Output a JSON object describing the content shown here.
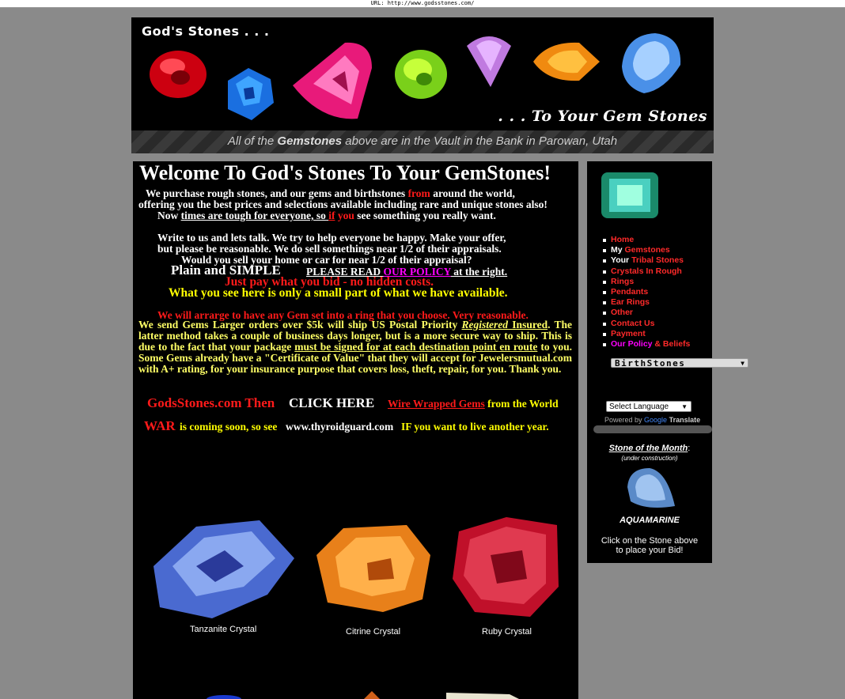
{
  "url_bar": "URL: http://www.godsstones.com/",
  "header": {
    "brand": "God's Stones . . .",
    "tagline": ". . . To Your Gem Stones",
    "vault_pre": "All of the ",
    "vault_bold": "Gemstones",
    "vault_post": " above are in the Vault in the Bank in Parowan, Utah"
  },
  "main": {
    "title": "Welcome To God's Stones To Your GemStones!",
    "l1a": "We purchase rough stones, and our gems and birthstones ",
    "l1b": "from",
    "l1c": " around the world,",
    "l2": "offering you the best prices and selections available including rare and unique stones also!",
    "l3a": "Now ",
    "l3b": "times are tough for everyone, so ",
    "l3c": "if",
    "l3d": " you",
    "l3e": " see something you really want.",
    "l4": "Write to us and lets talk. We try to help everyone be happy. Make your offer,",
    "l5": "but please be reasonable. We do sell somethings near 1/2 of their appraisals.",
    "l6": "Would you sell your home or car for near 1/2 of their appraisal?",
    "l7a": "Plain and SIMPLE",
    "l7b": "PLEASE READ ",
    "l7c": "OUR POLICY",
    "l7d": "  at the right. ",
    "l8": "Just pay what you bid - no hidden costs.",
    "l9": "What you see here is only a small part of what we have available.",
    "l10": "We will arrarge to have any Gem set into a ring that you choose. Very reasonable.",
    "j1": "We send Gems Larger orders over $5k will ship US Postal Priority ",
    "j2": "Registered",
    "j3": " Insured",
    "j4": ". The latter method takes a couple of business days longer, but is a more secure way to ship. This is due to the fact that your package ",
    "j5": "must be signed for at each destination point en route",
    "j6": " to you. Some Gems already have a \"Certificate of Value\" that they will accept for Jewelersmutual.com with A+ rating, for your insurance purpose that covers loss, theft, repair, for you.  Thank you.",
    "r1a": "GodsStones.com Then",
    "r1b": "CLICK HERE",
    "r1c": "Wire Wrapped Gems",
    "r1d": " from the World",
    "r2a": "WAR",
    "r2b": " is coming soon, so see",
    "r2c": "www.thyroidguard.com",
    "r2d": "IF you want to live another year.",
    "captions": [
      "Tanzanite Crystal",
      "Citrine Crystal",
      "Ruby Crystal"
    ]
  },
  "sidebar": {
    "menu": [
      {
        "pre": "",
        "label": "Home"
      },
      {
        "pre": "My ",
        "label": "Gemstones"
      },
      {
        "pre": "Your ",
        "label": "Tribal Stones"
      },
      {
        "pre": "",
        "label": "Crystals In Rough"
      },
      {
        "pre": "",
        "label": "Rings"
      },
      {
        "pre": "",
        "label": "Pendants"
      },
      {
        "pre": "",
        "label": "Ear Rings"
      },
      {
        "pre": "",
        "label": "Other"
      },
      {
        "pre": "",
        "label": "Contact Us"
      },
      {
        "pre": "",
        "label": "Payment"
      },
      {
        "pre": "",
        "label": "Our Policy",
        "post": " & Beliefs"
      }
    ],
    "birthstones": "BirthStones",
    "language": "Select Language",
    "powered_by": "Powered by ",
    "google": "Google",
    "translate": "Translate",
    "som_title": "Stone of the Month",
    "som_colon": ":",
    "som_note": "(under construction)",
    "som_stone": "AQUAMARINE",
    "som_click1": "Click on the Stone above",
    "som_click2": "to place your Bid!"
  },
  "colors": {
    "accent_red": "#ff1a1a",
    "yellow": "#ffff00",
    "magenta": "#ff00ff",
    "background": "#8a8a8a"
  }
}
